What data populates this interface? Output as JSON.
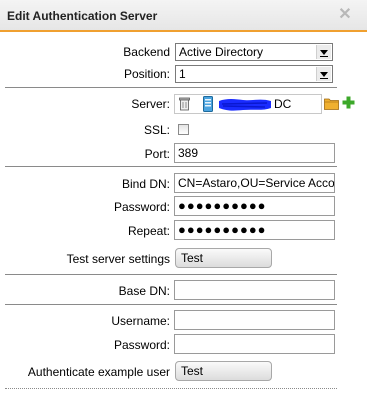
{
  "dialog": {
    "title": "Edit Authentication Server",
    "close_glyph": "✕"
  },
  "form": {
    "backend": {
      "label": "Backend",
      "value": "Active Directory"
    },
    "position": {
      "label": "Position:",
      "value": "1"
    },
    "server": {
      "label": "Server:",
      "name_suffix": "DC"
    },
    "ssl": {
      "label": "SSL:",
      "checked": false
    },
    "port": {
      "label": "Port:",
      "value": "389"
    },
    "bind_dn": {
      "label": "Bind DN:",
      "value": "CN=Astaro,OU=Service Acco"
    },
    "password": {
      "label": "Password:",
      "value": "●●●●●●●●●●"
    },
    "repeat": {
      "label": "Repeat:",
      "value": "●●●●●●●●●●"
    },
    "test_server": {
      "label": "Test server settings",
      "button": "Test"
    },
    "base_dn": {
      "label": "Base DN:",
      "value": ""
    },
    "username": {
      "label": "Username:",
      "value": ""
    },
    "password2": {
      "label": "Password:",
      "value": ""
    },
    "auth_example": {
      "label": "Authenticate example user",
      "button": "Test"
    }
  },
  "icons": {
    "close": "close-icon",
    "trash": "trash-icon",
    "server": "server-icon",
    "folder": "folder-icon",
    "add": "plus-icon",
    "dropdown": "chevron-down-icon"
  },
  "colors": {
    "title_accent": "#f0a030",
    "redaction": "#1a2cff",
    "add_icon": "#3ca82a",
    "folder_icon": "#e8a020"
  }
}
